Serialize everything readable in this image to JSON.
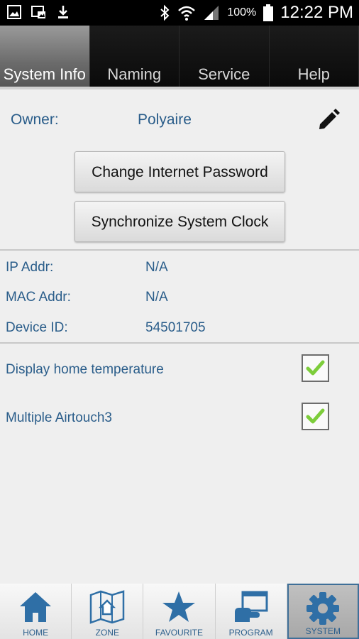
{
  "status_bar": {
    "battery": "100%",
    "time": "12:22 PM",
    "icons": [
      "gallery-icon",
      "screenshot-icon",
      "download-icon",
      "bluetooth-icon",
      "wifi-icon",
      "signal-icon",
      "battery-icon"
    ]
  },
  "tabs": [
    {
      "label": "System Info",
      "active": true
    },
    {
      "label": "Naming",
      "active": false
    },
    {
      "label": "Service",
      "active": false
    },
    {
      "label": "Help",
      "active": false
    }
  ],
  "owner": {
    "label": "Owner:",
    "value": "Polyaire"
  },
  "buttons": {
    "change_password": "Change Internet Password",
    "sync_clock": "Synchronize System Clock"
  },
  "info": {
    "ip": {
      "label": "IP Addr:",
      "value": "N/A"
    },
    "mac": {
      "label": "MAC Addr:",
      "value": "N/A"
    },
    "device": {
      "label": "Device ID:",
      "value": "54501705"
    }
  },
  "options": [
    {
      "label": "Display home temperature",
      "checked": true
    },
    {
      "label": "Multiple Airtouch3",
      "checked": true
    }
  ],
  "bottom_nav": [
    {
      "label": "HOME",
      "icon": "home-icon",
      "active": false
    },
    {
      "label": "ZONE",
      "icon": "zone-map-icon",
      "active": false
    },
    {
      "label": "FAVOURITE",
      "icon": "star-icon",
      "active": false
    },
    {
      "label": "PROGRAM",
      "icon": "program-icon",
      "active": false
    },
    {
      "label": "SYSTEM",
      "icon": "gear-icon",
      "active": true
    }
  ],
  "colors": {
    "accent": "#2a5d8a",
    "check": "#7dcd3b",
    "nav_icon": "#2f6fa6"
  }
}
